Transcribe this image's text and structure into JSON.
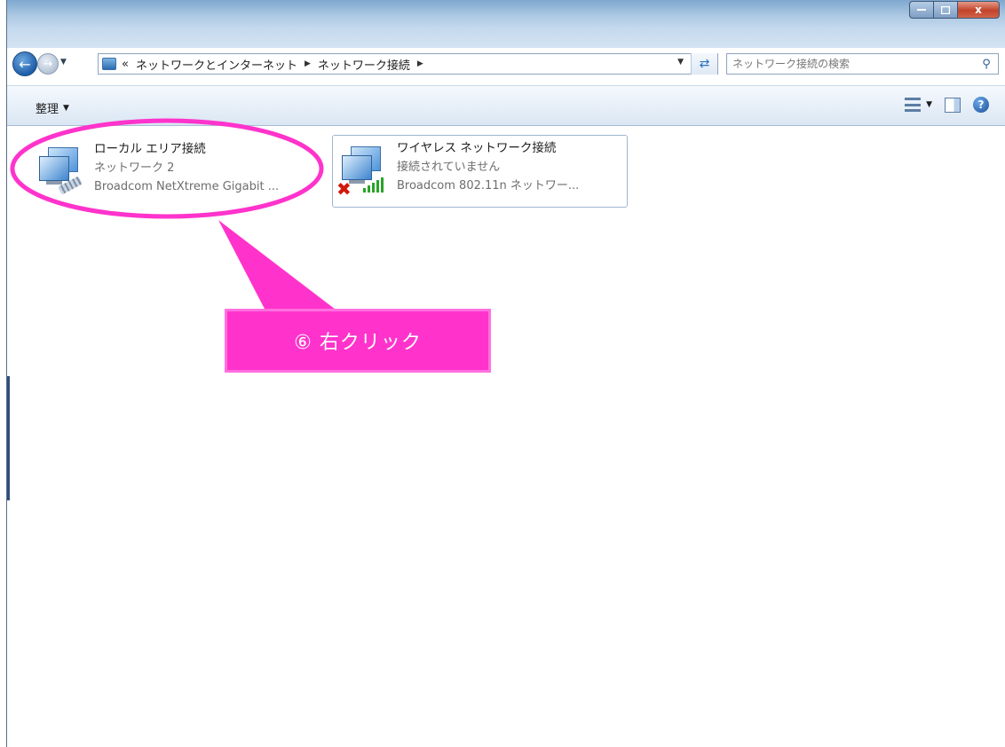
{
  "window": {
    "caption_close": "x"
  },
  "navigation": {
    "address_overflow": "«",
    "breadcrumbs": [
      "ネットワークとインターネット",
      "ネットワーク接続"
    ]
  },
  "search": {
    "placeholder": "ネットワーク接続の検索"
  },
  "commandbar": {
    "organize_label": "整理"
  },
  "connections": [
    {
      "name": "ローカル エリア接続",
      "status": "ネットワーク 2",
      "device": "Broadcom NetXtreme Gigabit ...",
      "icon": "wired-network-icon",
      "selected": false
    },
    {
      "name": "ワイヤレス ネットワーク接続",
      "status": "接続されていません",
      "device": "Broadcom 802.11n ネットワー...",
      "icon": "wireless-network-disconnected-icon",
      "selected": true
    }
  ],
  "annotation": {
    "callout_text": "⑥ 右クリック",
    "color": "#ff33cc"
  }
}
